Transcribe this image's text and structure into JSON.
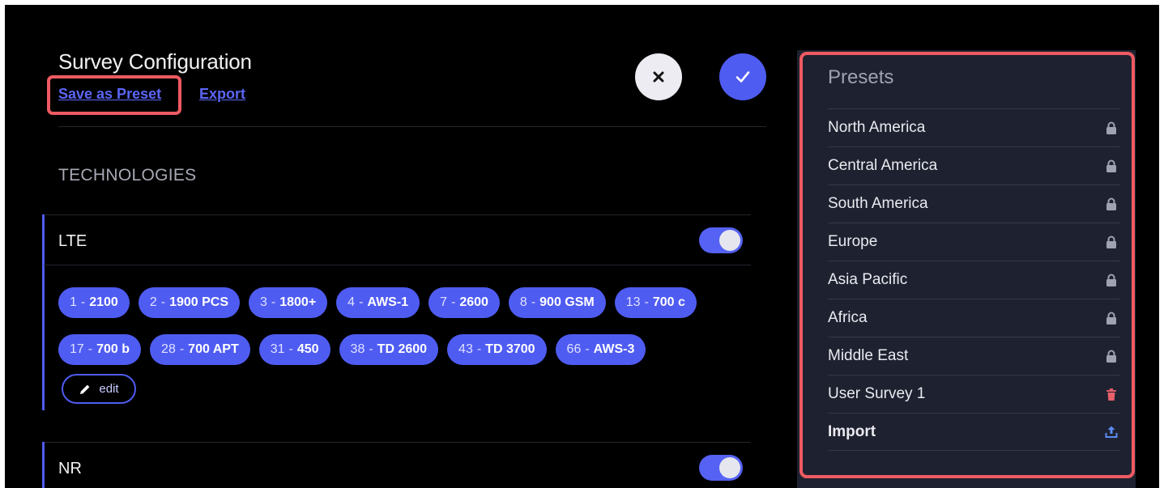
{
  "header": {
    "title": "Survey Configuration",
    "save_preset_label": "Save as Preset",
    "export_label": "Export",
    "cancel_icon": "close-icon",
    "confirm_icon": "check-icon"
  },
  "technologies": {
    "section_title": "TECHNOLOGIES",
    "items": [
      {
        "label": "LTE",
        "enabled": true,
        "bands_rows": [
          [
            {
              "num": "1",
              "name": "2100"
            },
            {
              "num": "2",
              "name": "1900 PCS"
            },
            {
              "num": "3",
              "name": "1800+"
            },
            {
              "num": "4",
              "name": "AWS-1"
            },
            {
              "num": "7",
              "name": "2600"
            },
            {
              "num": "8",
              "name": "900 GSM"
            },
            {
              "num": "13",
              "name": "700 c"
            }
          ],
          [
            {
              "num": "17",
              "name": "700 b"
            },
            {
              "num": "28",
              "name": "700 APT"
            },
            {
              "num": "31",
              "name": "450"
            },
            {
              "num": "38",
              "name": "TD 2600"
            },
            {
              "num": "43",
              "name": "TD 3700"
            },
            {
              "num": "66",
              "name": "AWS-3"
            }
          ]
        ],
        "band_separator": "-",
        "edit_label": "edit"
      },
      {
        "label": "NR",
        "enabled": true
      }
    ]
  },
  "presets": {
    "title": "Presets",
    "items": [
      {
        "label": "North America",
        "icon": "lock-icon"
      },
      {
        "label": "Central America",
        "icon": "lock-icon"
      },
      {
        "label": "South America",
        "icon": "lock-icon"
      },
      {
        "label": "Europe",
        "icon": "lock-icon"
      },
      {
        "label": "Asia Pacific",
        "icon": "lock-icon"
      },
      {
        "label": "Africa",
        "icon": "lock-icon"
      },
      {
        "label": "Middle East",
        "icon": "lock-icon"
      },
      {
        "label": "User Survey 1",
        "icon": "trash-icon"
      },
      {
        "label": "Import",
        "icon": "upload-icon"
      }
    ]
  },
  "colors": {
    "accent": "#4f5cf2",
    "highlight": "#ef5a62",
    "trash": "#e8606a",
    "panel_bg": "#1e2230"
  }
}
